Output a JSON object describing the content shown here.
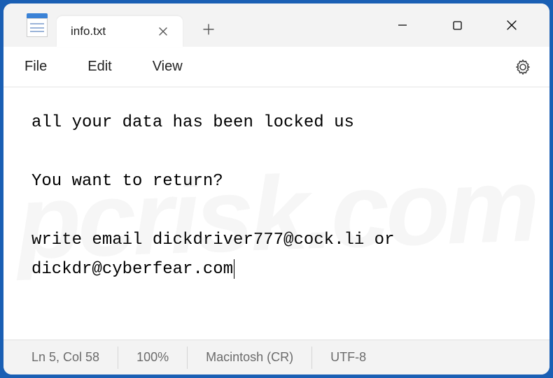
{
  "titlebar": {
    "tab_title": "info.txt"
  },
  "menubar": {
    "file": "File",
    "edit": "Edit",
    "view": "View"
  },
  "content": {
    "line1": "all your data has been locked us",
    "line2": "You want to return?",
    "line3": "write email dickdriver777@cock.li or dickdr@cyberfear.com"
  },
  "statusbar": {
    "position": "Ln 5, Col 58",
    "zoom": "100%",
    "line_ending": "Macintosh (CR)",
    "encoding": "UTF-8"
  },
  "icons": {
    "close_tab": "close-icon",
    "new_tab": "plus-icon",
    "minimize": "minimize-icon",
    "maximize": "maximize-icon",
    "close_window": "close-icon",
    "settings": "gear-icon",
    "app": "notepad-icon"
  }
}
